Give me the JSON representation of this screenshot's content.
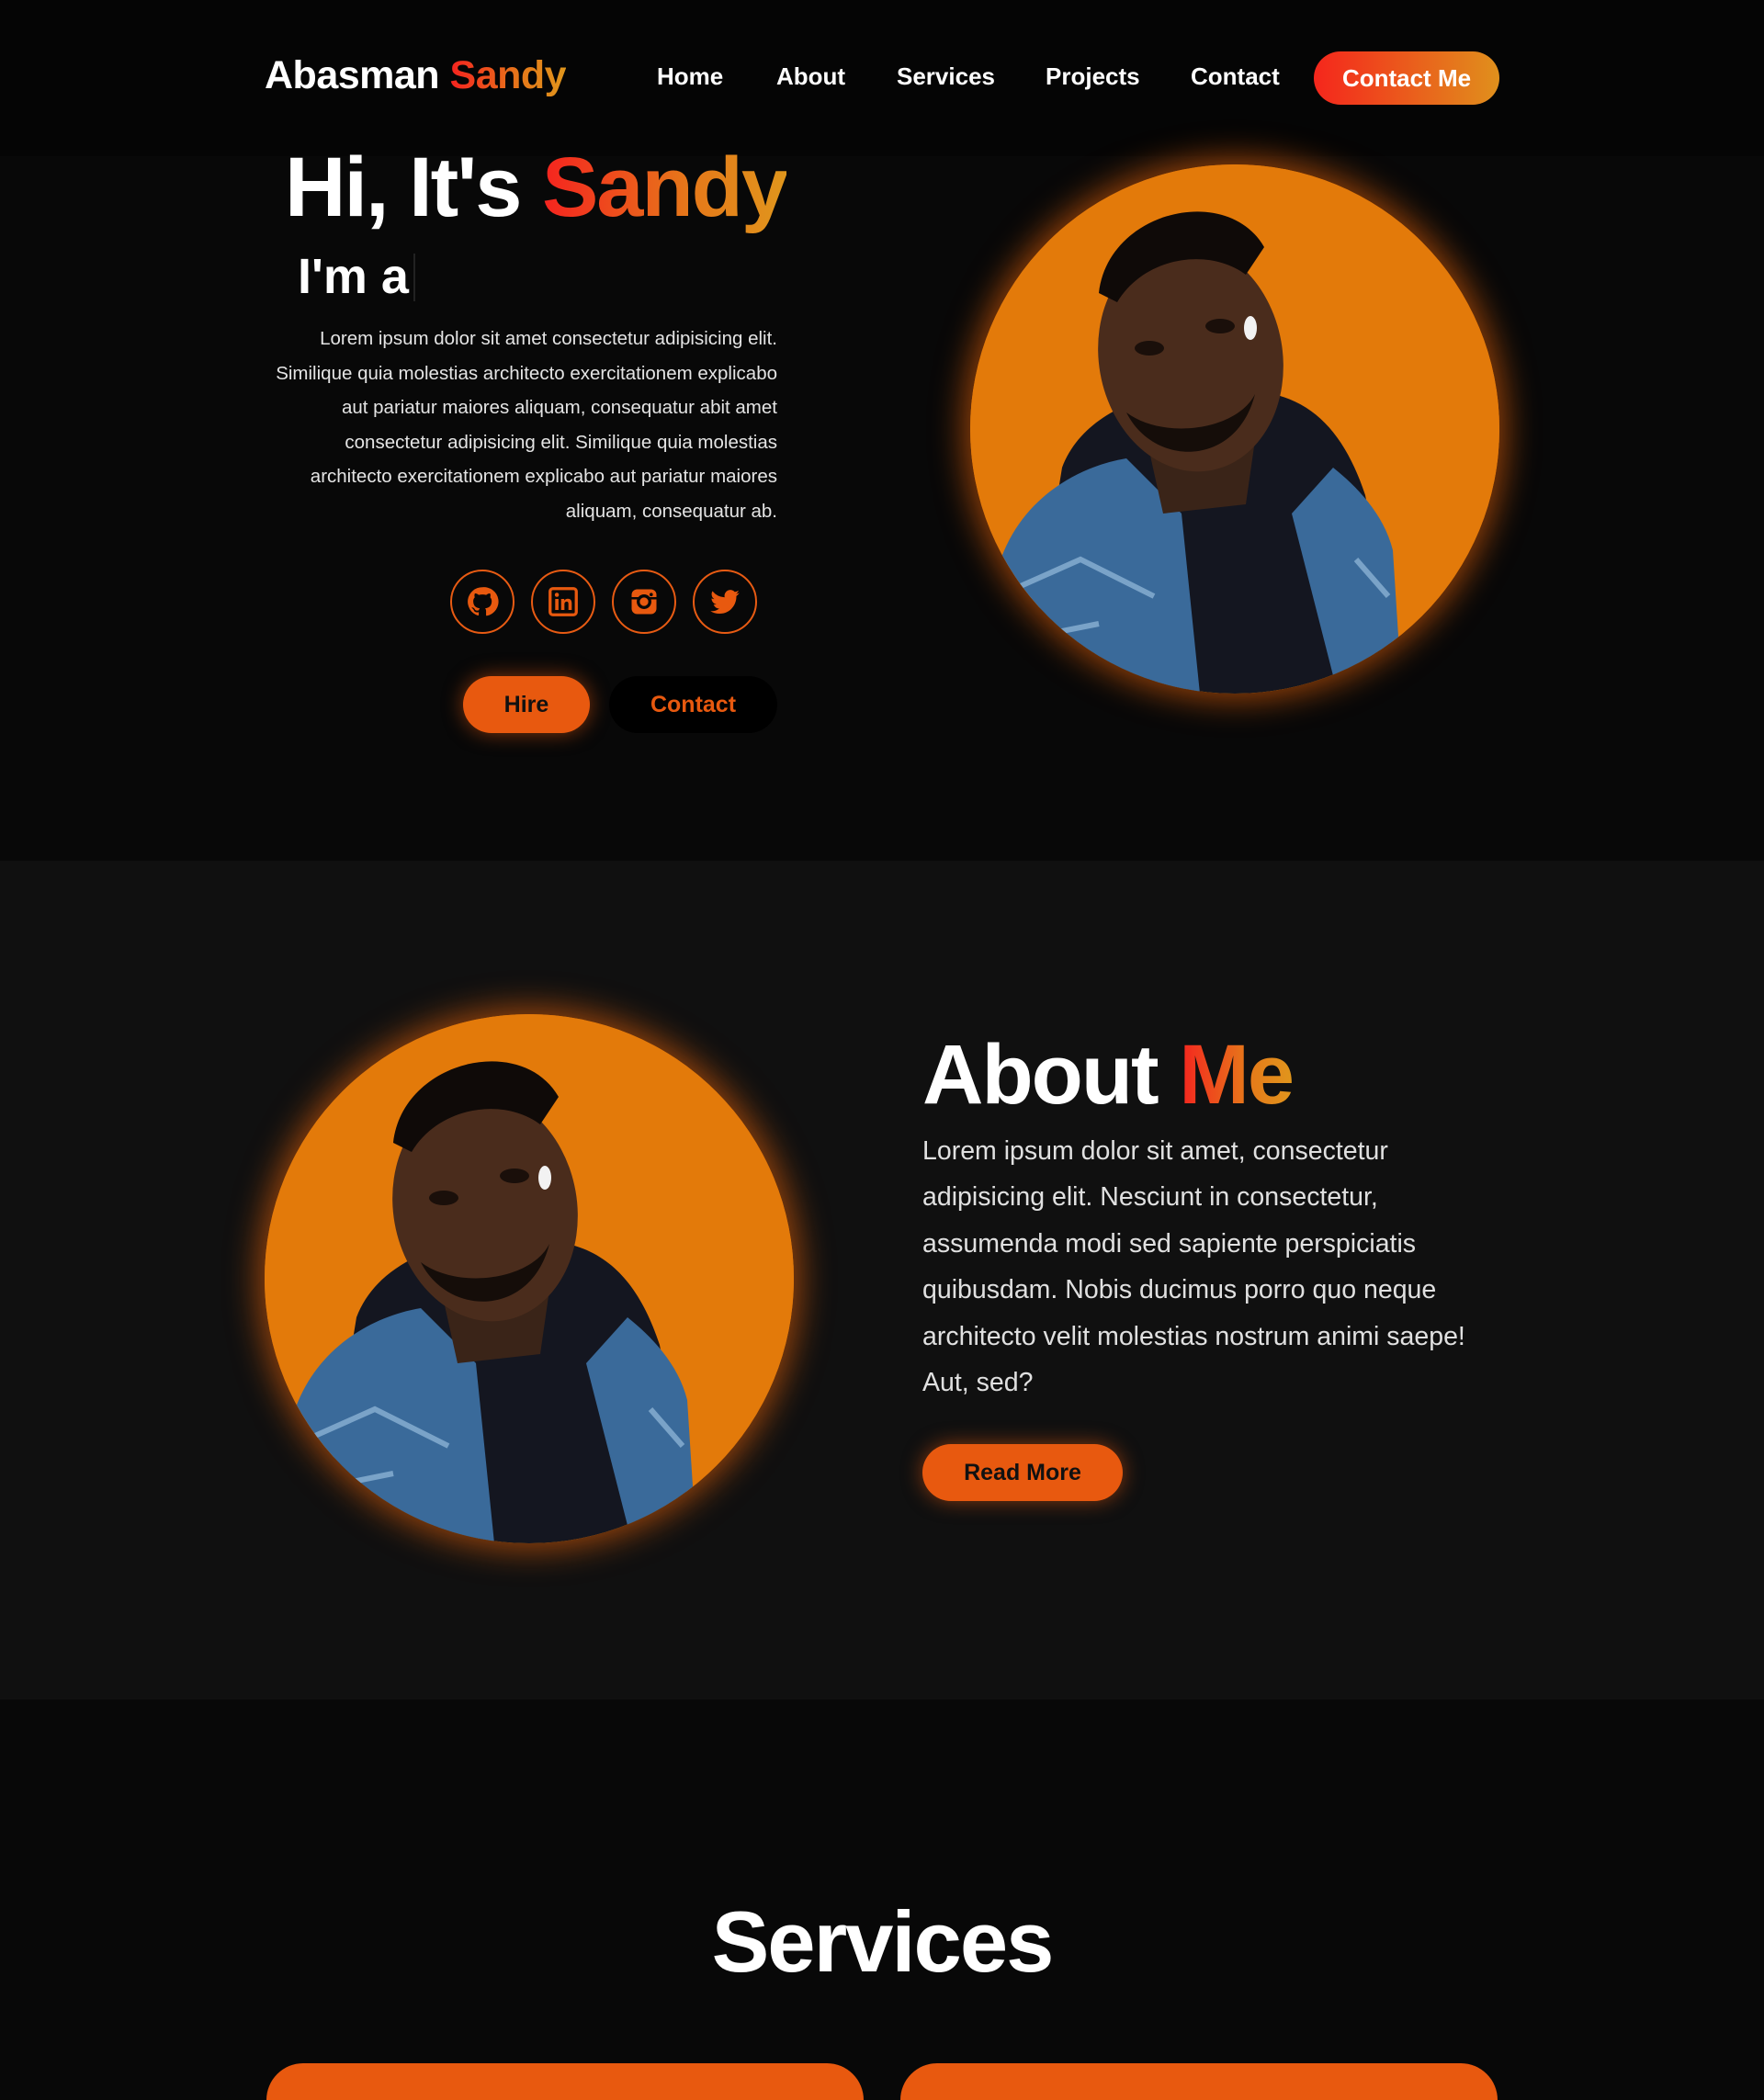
{
  "header": {
    "logo_first": "Abasman",
    "logo_second": "Sandy",
    "nav": [
      "Home",
      "About",
      "Services",
      "Projects",
      "Contact"
    ],
    "cta_label": "Contact Me"
  },
  "hero": {
    "greeting": "Hi, It's",
    "name": "Sandy",
    "role_prefix": "I'm a",
    "description": "Lorem ipsum dolor sit amet consectetur adipisicing elit. Similique quia molestias architecto exercitationem explicabo aut pariatur maiores aliquam, consequatur abit amet consectetur adipisicing elit. Similique quia molestias architecto exercitationem explicabo aut pariatur maiores aliquam, consequatur ab.",
    "socials": [
      "github-icon",
      "linkedin-icon",
      "instagram-icon",
      "twitter-icon"
    ],
    "hire_label": "Hire",
    "contact_label": "Contact"
  },
  "about": {
    "title_first": "About",
    "title_second": "Me",
    "description": "Lorem ipsum dolor sit amet, consectetur adipisicing elit. Nesciunt in consectetur, assumenda modi sed sapiente perspiciatis quibusdam. Nobis ducimus porro quo neque architecto velit molestias nostrum animi saepe! Aut, sed?",
    "read_more_label": "Read More"
  },
  "services": {
    "title": "Services"
  },
  "colors": {
    "accent": "#e8590f",
    "gradient_start": "#f5231f",
    "gradient_end": "#e0961c",
    "portrait_bg": "#e37a0a",
    "background": "#080808",
    "section_alt": "#101010"
  }
}
